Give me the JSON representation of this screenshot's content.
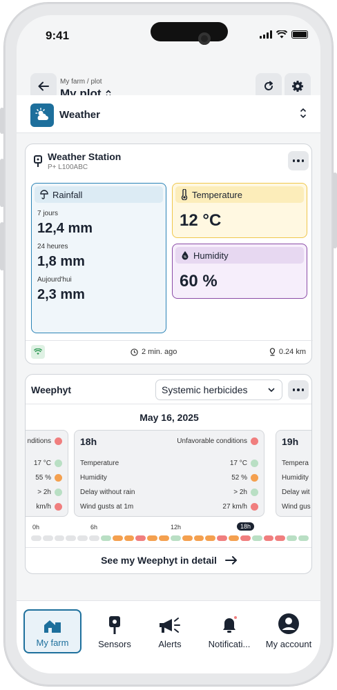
{
  "status_bar": {
    "time": "9:41"
  },
  "header": {
    "breadcrumb": "My farm / plot",
    "title": "My plot"
  },
  "section": {
    "label": "Weather"
  },
  "weather_station": {
    "title": "Weather Station",
    "id": "P+ L100ABC",
    "rainfall": {
      "label": "Rainfall",
      "rows": [
        {
          "period": "7 jours",
          "value": "12,4 mm"
        },
        {
          "period": "24 heures",
          "value": "1,8 mm"
        },
        {
          "period": "Aujourd'hui",
          "value": "2,3 mm"
        }
      ]
    },
    "temperature": {
      "label": "Temperature",
      "value": "12 °C"
    },
    "humidity": {
      "label": "Humidity",
      "value": "60 %"
    },
    "updated": "2 min. ago",
    "distance": "0.24 km"
  },
  "weephyt": {
    "title": "Weephyt",
    "select_value": "Systemic herbicides",
    "date": "May 16, 2025",
    "left_card": {
      "status": "nditions",
      "values": [
        "17 °C",
        "55 %",
        "> 2h",
        "km/h"
      ]
    },
    "main_card": {
      "hour": "18h",
      "status": "Unfavorable conditions",
      "rows": [
        {
          "label": "Temperature",
          "value": "17 °C"
        },
        {
          "label": "Humidity",
          "value": "52 %"
        },
        {
          "label": "Delay without rain",
          "value": "> 2h"
        },
        {
          "label": "Wind gusts at 1m",
          "value": "27 km/h"
        }
      ]
    },
    "right_card": {
      "hour": "19h",
      "labels": [
        "Tempera",
        "Humidity",
        "Delay wit",
        "Wind gus"
      ]
    },
    "ticks": [
      "0h",
      "6h",
      "12h",
      "18h"
    ],
    "detail_label": "See my Weephyt in detail"
  },
  "tabs": [
    {
      "label": "My farm",
      "icon": "farm-icon"
    },
    {
      "label": "Sensors",
      "icon": "sensor-icon"
    },
    {
      "label": "Alerts",
      "icon": "megaphone-icon"
    },
    {
      "label": "Notificati...",
      "icon": "bell-icon"
    },
    {
      "label": "My account",
      "icon": "account-icon"
    }
  ],
  "colors": {
    "accent": "#1d6f9c",
    "favorable": "#b9dfc4",
    "medium": "#f4a04f",
    "unfavorable": "#f07e7e"
  }
}
